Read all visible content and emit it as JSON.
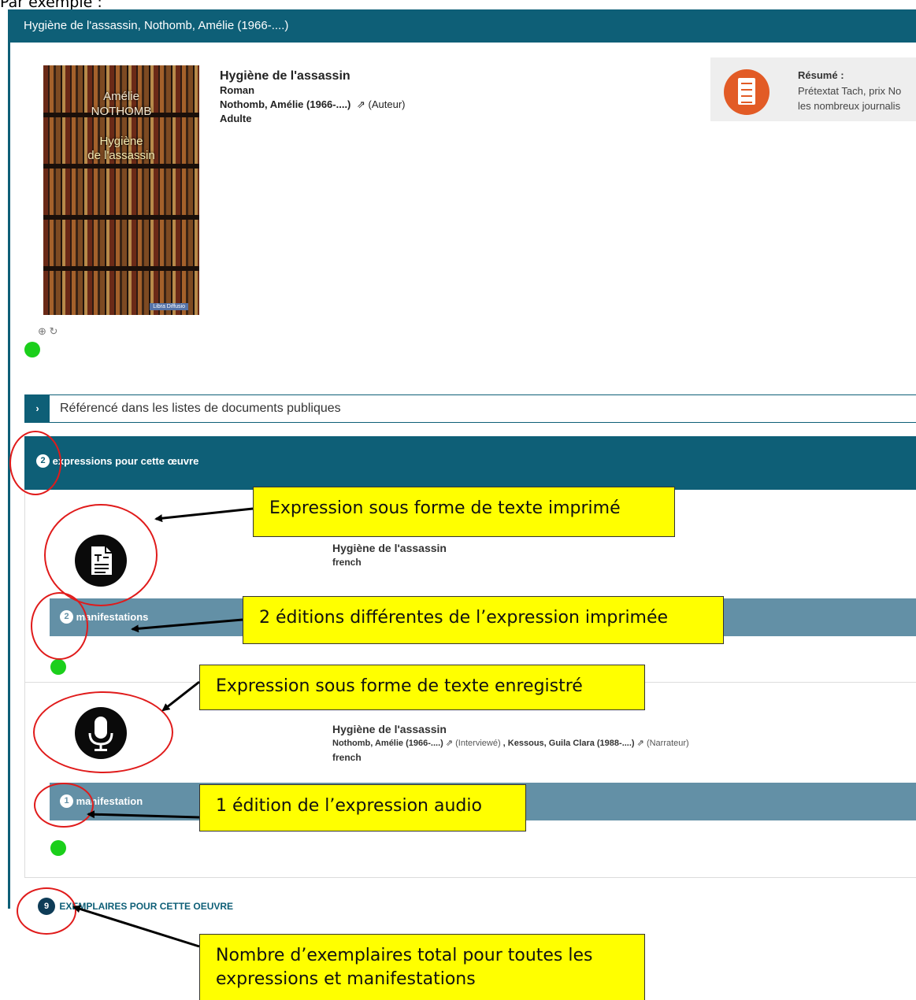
{
  "intro": "Par exemple :",
  "header": {
    "title": "Hygiène de l'assassin, Nothomb, Amélie (1966-....)"
  },
  "cover": {
    "author_line1": "Amélie",
    "author_line2": "NOTHOMB",
    "title_line1": "Hygiène",
    "title_line2": "de l'assassin",
    "publisher": "Libra Diffusio",
    "icons": "⊕ ↻"
  },
  "work": {
    "title": "Hygiène de l'assassin",
    "genre": "Roman",
    "author": "Nothomb, Amélie (1966-....)",
    "author_role": "(Auteur)",
    "audience": "Adulte"
  },
  "resume": {
    "label": "Résumé :",
    "line1": "Prétextat Tach, prix No",
    "line2": "les nombreux journalis"
  },
  "referenced": {
    "toggle": "›",
    "label": "Référencé dans les listes de documents publiques"
  },
  "expressions": {
    "count": "2",
    "label": "expressions pour cette œuvre",
    "items": [
      {
        "icon": "printed-text-icon",
        "title": "Hygiène de l'assassin",
        "language": "french",
        "manif_count": "2",
        "manif_label": "manifestations"
      },
      {
        "icon": "microphone-icon",
        "title": "Hygiène de l'assassin",
        "contributors": "Nothomb, Amélie (1966-....)",
        "role1": "(Interviewé)",
        "sep": ",",
        "contributor2": "Kessous, Guila Clara (1988-....)",
        "role2": "(Narrateur)",
        "language": "french",
        "manif_count": "1",
        "manif_label": "manifestation"
      }
    ]
  },
  "copies": {
    "count": "9",
    "label": "EXEMPLAIRES POUR CETTE OEUVRE"
  },
  "callouts": {
    "printed": "Expression sous forme de texte imprimé",
    "editions_printed": "2 éditions différentes de l’expression imprimée",
    "recorded": "Expression sous forme de texte enregistré",
    "edition_audio": "1 édition de l’expression audio",
    "total_copies_line1": "Nombre d’exemplaires total pour toutes les",
    "total_copies_line2": "expressions et manifestations"
  },
  "colors": {
    "primary": "#0e5f77",
    "manifestation": "#6390a6",
    "status_green": "#1bcf1b",
    "callout": "#ffff00",
    "ring": "#e01b1b"
  }
}
